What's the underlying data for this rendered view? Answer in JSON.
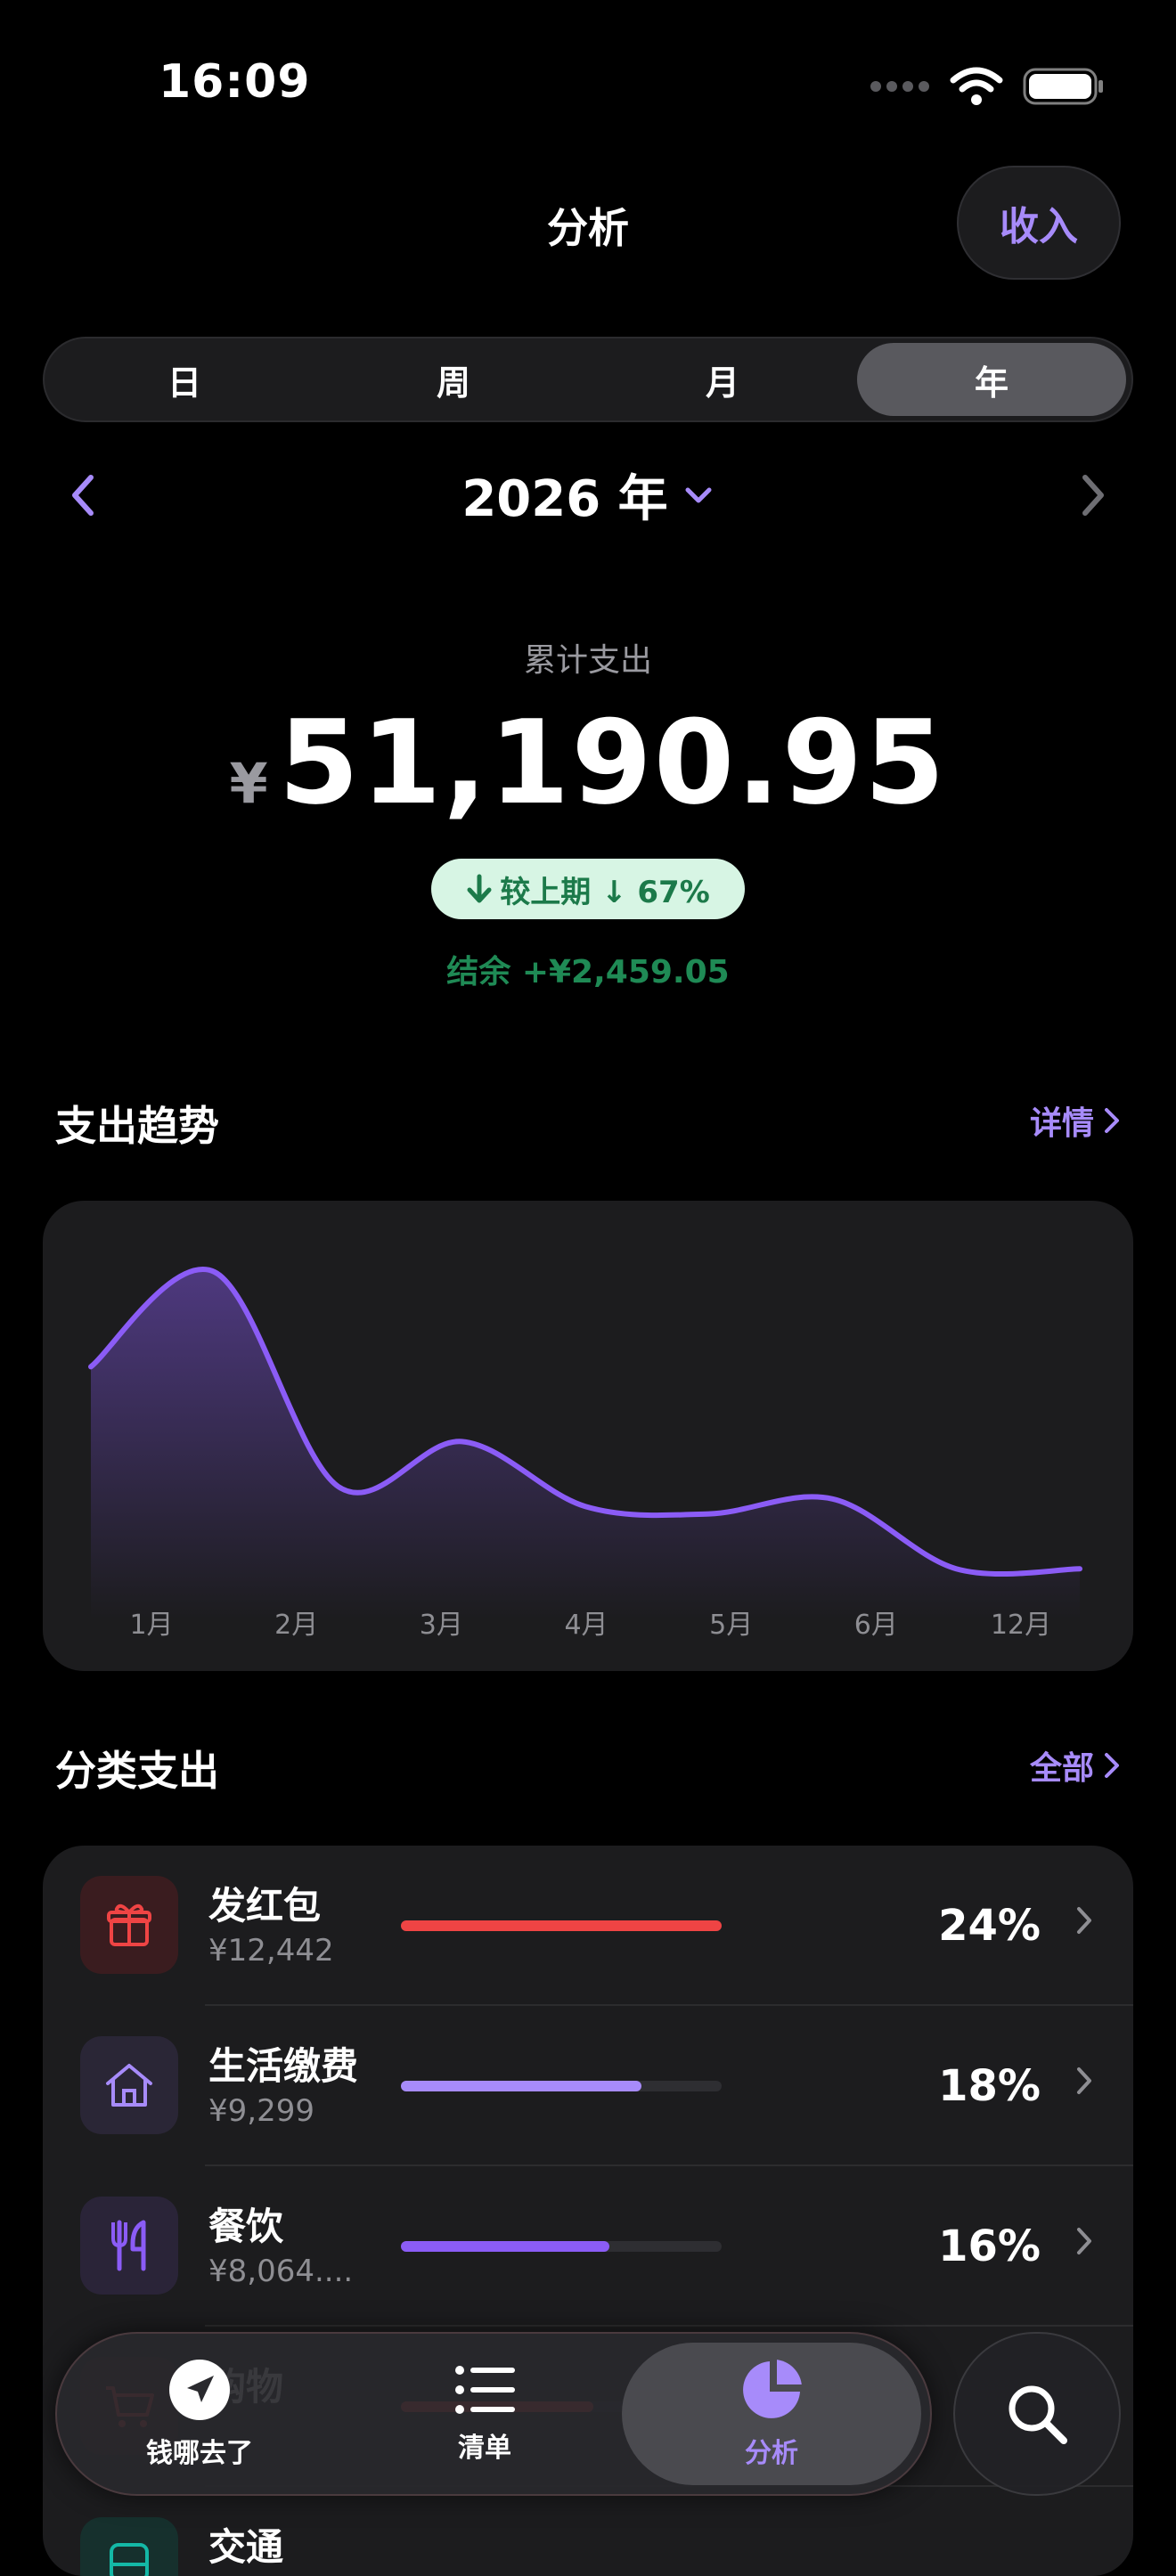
{
  "status_bar": {
    "time": "16:09"
  },
  "header": {
    "title": "分析",
    "income_label": "收入"
  },
  "segments": [
    {
      "label": "日",
      "active": false
    },
    {
      "label": "周",
      "active": false
    },
    {
      "label": "月",
      "active": false
    },
    {
      "label": "年",
      "active": true
    }
  ],
  "period": {
    "label": "2026 年"
  },
  "summary": {
    "total_label": "累计支出",
    "currency": "¥",
    "total_amount": "51,190.95",
    "compare": "较上期 ↓ 67%",
    "balance": "结余 +¥2,459.05"
  },
  "trend": {
    "title": "支出趋势",
    "link_label": "详情"
  },
  "chart_data": {
    "type": "area",
    "x_labels": [
      "1月",
      "2月",
      "3月",
      "4月",
      "5月",
      "6月",
      "12月"
    ],
    "series": [
      {
        "values": [
          8700,
          12500,
          3900,
          5700,
          3100,
          2800,
          3400,
          600,
          600
        ]
      }
    ],
    "grid": false,
    "color": "#8b5cf6"
  },
  "categories": {
    "title": "分类支出",
    "link_label": "全部",
    "items": [
      {
        "name": "发红包",
        "amount": "¥12,442",
        "percent_label": "24%",
        "fill_ratio": 1.0,
        "color": "#ef4444",
        "icon_bg": "#3a1c1f",
        "icon": "gift-icon"
      },
      {
        "name": "生活缴费",
        "amount": "¥9,299",
        "percent_label": "18%",
        "fill_ratio": 0.75,
        "color": "#a78bfa",
        "icon_bg": "#2a2636",
        "icon": "home-icon"
      },
      {
        "name": "餐饮",
        "amount": "¥8,064....",
        "percent_label": "16%",
        "fill_ratio": 0.65,
        "color": "#8b5cf6",
        "icon_bg": "#2a2438",
        "icon": "utensils-icon"
      },
      {
        "name": "购物",
        "amount": "",
        "percent_label": "",
        "fill_ratio": 0.6,
        "color": "#ef4444",
        "icon_bg": "#3a1c1f",
        "icon": "cart-icon"
      },
      {
        "name": "交通",
        "amount": "",
        "percent_label": "",
        "fill_ratio": 0.4,
        "color": "#14b8a6",
        "icon_bg": "#16302d",
        "icon": "bus-icon"
      }
    ]
  },
  "tabbar": {
    "tabs": [
      {
        "label": "钱哪去了",
        "icon": "navigation-arrow-icon",
        "active": false
      },
      {
        "label": "清单",
        "icon": "list-icon",
        "active": false
      },
      {
        "label": "分析",
        "icon": "pie-chart-icon",
        "active": true
      }
    ]
  },
  "colors": {
    "accent": "#a78bfa",
    "positive": "#1f8a55",
    "badge_bg": "#d7f5e4"
  }
}
